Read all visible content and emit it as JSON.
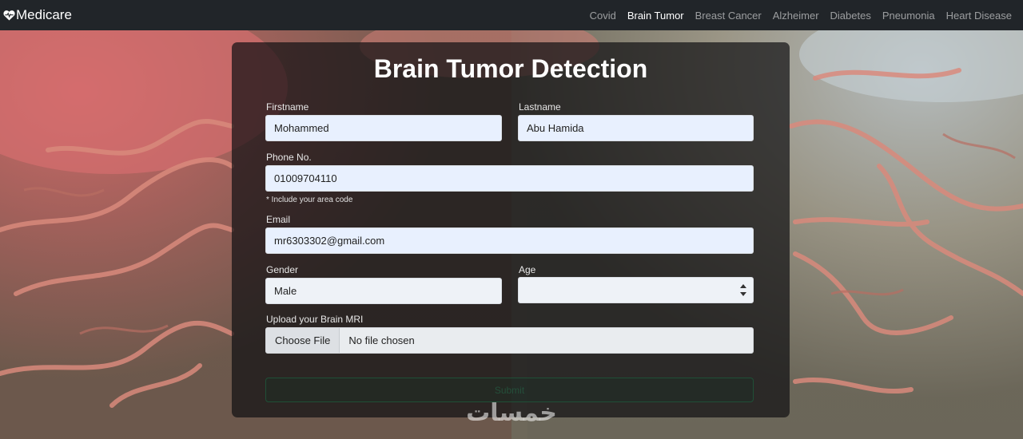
{
  "navbar": {
    "brand": "Medicare",
    "links": [
      "Covid",
      "Brain Tumor",
      "Breast Cancer",
      "Alzheimer",
      "Diabetes",
      "Pneumonia",
      "Heart Disease"
    ],
    "active": "Brain Tumor"
  },
  "form": {
    "title": "Brain Tumor Detection",
    "firstname": {
      "label": "Firstname",
      "value": "Mohammed"
    },
    "lastname": {
      "label": "Lastname",
      "value": "Abu Hamida"
    },
    "phone": {
      "label": "Phone No.",
      "value": "01009704110",
      "help": "* Include your area code"
    },
    "email": {
      "label": "Email",
      "value": "mr6303302@gmail.com"
    },
    "gender": {
      "label": "Gender",
      "value": "Male"
    },
    "age": {
      "label": "Age",
      "value": ""
    },
    "upload": {
      "label": "Upload your Brain MRI",
      "button": "Choose File",
      "status": "No file chosen"
    },
    "submit": "Submit"
  },
  "watermark": "خمسات"
}
